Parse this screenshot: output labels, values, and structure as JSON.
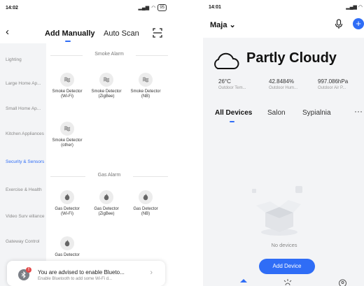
{
  "left": {
    "status": {
      "time": "14:02",
      "battery": "95"
    },
    "header": {
      "tab_add": "Add Manually",
      "tab_auto": "Auto Scan"
    },
    "sidebar": {
      "items": [
        {
          "label": "Lighting"
        },
        {
          "label": "Large Home Ap..."
        },
        {
          "label": "Small Home Ap..."
        },
        {
          "label": "Kitchen Appliances"
        },
        {
          "label": "Security & Sensors"
        },
        {
          "label": "Exercise & Health"
        },
        {
          "label": "Video Surv eillance"
        },
        {
          "label": "Gateway Control"
        }
      ]
    },
    "sections": {
      "smoke": {
        "title": "Smoke Alarm",
        "devices": [
          {
            "label": "Smoke Detector (Wi-Fi)"
          },
          {
            "label": "Smoke Detector (ZigBee)"
          },
          {
            "label": "Smoke Detector (NB)"
          },
          {
            "label": "Smoke Detector (other)"
          }
        ]
      },
      "gas": {
        "title": "Gas Alarm",
        "devices": [
          {
            "label": "Gas Detector (Wi-Fi)"
          },
          {
            "label": "Gas Detector (ZigBee)"
          },
          {
            "label": "Gas Detector (NB)"
          },
          {
            "label": "Gas Detector"
          }
        ]
      }
    },
    "banner": {
      "title": "You are advised to enable Blueto...",
      "subtitle": "Enable Bluetooth to add some Wi-Fi d...",
      "badge": "!"
    }
  },
  "right": {
    "status": {
      "time": "14:01"
    },
    "home": {
      "name": "Maja ⌄"
    },
    "weather": {
      "condition": "Partly Cloudy",
      "metrics": [
        {
          "value": "26°C",
          "label": "Outdoor Tem..."
        },
        {
          "value": "42.8484%",
          "label": "Outdoor Hum..."
        },
        {
          "value": "997.086hPa",
          "label": "Outdoor Air P..."
        }
      ]
    },
    "rooms": {
      "tabs": [
        "All Devices",
        "Salon",
        "Sypialnia"
      ],
      "more": "···"
    },
    "empty": {
      "message": "No devices",
      "button": "Add Device"
    }
  },
  "colors": {
    "accent": "#2f6df6",
    "sidebar_bg": "#f3f4f6",
    "alert": "#e24a4a"
  }
}
